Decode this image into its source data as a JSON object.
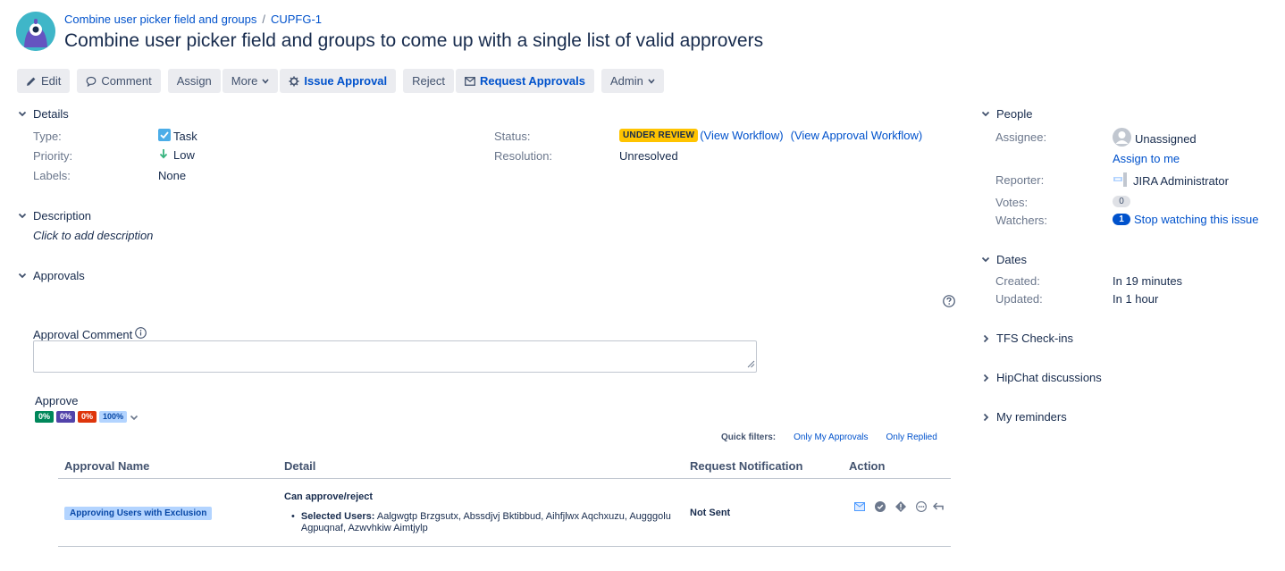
{
  "breadcrumb": {
    "project": "Combine user picker field and groups",
    "issue_key": "CUPFG-1"
  },
  "issue": {
    "title": "Combine user picker field and groups to come up with a single list of valid approvers"
  },
  "toolbar": {
    "edit": "Edit",
    "comment": "Comment",
    "assign": "Assign",
    "more": "More",
    "issue_approval": "Issue Approval",
    "reject": "Reject",
    "request_approvals": "Request Approvals",
    "admin": "Admin"
  },
  "details": {
    "heading": "Details",
    "type_label": "Type:",
    "type_value": "Task",
    "priority_label": "Priority:",
    "priority_value": "Low",
    "labels_label": "Labels:",
    "labels_value": "None",
    "status_label": "Status:",
    "status_value": "UNDER REVIEW",
    "view_workflow": "(View Workflow)",
    "view_approval_workflow": "(View Approval Workflow)",
    "resolution_label": "Resolution:",
    "resolution_value": "Unresolved"
  },
  "description": {
    "heading": "Description",
    "placeholder": "Click to add description"
  },
  "approvals": {
    "heading": "Approvals",
    "comment_label": "Approval Comment",
    "approve_label": "Approve",
    "progress": [
      {
        "label": "0%",
        "color": "#00875a"
      },
      {
        "label": "0%",
        "color": "#5243aa"
      },
      {
        "label": "0%",
        "color": "#de350b"
      },
      {
        "label": "100%",
        "color": "#b3d4ff"
      }
    ],
    "quick_filters_label": "Quick filters:",
    "filter_my": "Only My Approvals",
    "filter_replied": "Only Replied",
    "columns": [
      "Approval Name",
      "Detail",
      "Request Notification",
      "Action"
    ],
    "rows": [
      {
        "name": "Approving Users with Exclusion",
        "detail_title": "Can approve/reject",
        "selected_users_label": "Selected Users:",
        "selected_users": "Aalgwgtp Brzgsutx, Abssdjvj Bktibbud, Aihfjlwx Aqchxuzu, Augggolu Agpuqnaf, Azwvhkiw Aimtjylp",
        "notification": "Not Sent"
      }
    ]
  },
  "people": {
    "heading": "People",
    "assignee_label": "Assignee:",
    "assignee_value": "Unassigned",
    "assign_to_me": "Assign to me",
    "reporter_label": "Reporter:",
    "reporter_value": "JIRA Administrator",
    "votes_label": "Votes:",
    "votes_value": "0",
    "watchers_label": "Watchers:",
    "watchers_value": "1",
    "stop_watching": "Stop watching this issue"
  },
  "dates": {
    "heading": "Dates",
    "created_label": "Created:",
    "created_value": "In 19 minutes",
    "updated_label": "Updated:",
    "updated_value": "In 1 hour"
  },
  "collapsed_panels": {
    "tfs": "TFS Check-ins",
    "hipchat": "HipChat discussions",
    "reminders": "My reminders"
  }
}
